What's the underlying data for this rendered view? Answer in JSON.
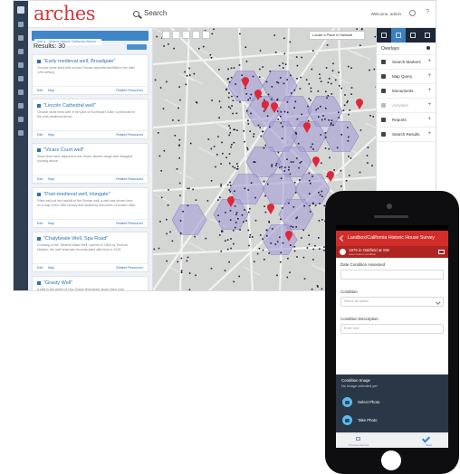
{
  "app": {
    "logo": "arches",
    "search_label": "Search",
    "welcome": "Welcome, admin",
    "help_glyph": "?"
  },
  "results": {
    "filter_tag": "Add a... Search Historic California Historic...",
    "count_label": "Results: 30",
    "items": [
      {
        "title": "\"Early medieval well, Broadgate\"",
        "desc": "Circular stone lined well cut into Roman deposits identified in the later 12th century.",
        "link1": "Edit",
        "link2": "Map",
        "related": "Related Resources"
      },
      {
        "title": "\"Lincoln Cathedral well\"",
        "desc": "Circular stone lined well in the yard of Exchequer Gate, constructed in the post-medieval period.",
        "link1": "Edit",
        "link2": "Map",
        "related": "Related Resources"
      },
      {
        "title": "\"Vicars Court well\"",
        "desc": "Stone lined well, adjacent to the Vicars' kitchen range with drawgear housing above.",
        "link1": "Edit",
        "link2": "Map",
        "related": "Related Resources"
      },
      {
        "title": "\"Post-medieval well, Hungate\"",
        "desc": "Filled well cut into backfill of the Roman wall; a well was shown here on a map of the 18th century and sealed by structures of modern date.",
        "link1": "Edit",
        "link2": "Map",
        "related": "Related Resources"
      },
      {
        "title": "\"Chalybeate Well, Spa Road\"",
        "desc": "Covering of the \"Mineral Water Well\" opened in 1834 by Thomas Haddon, the well head was reconstructed with brick in 1919.",
        "link1": "Edit",
        "link2": "Map",
        "related": "Related Resources"
      },
      {
        "title": "\"Grasty Well\"",
        "desc": "A well in the centre of Hoy Grasty Hmpstead, stone lined, now covered.",
        "link1": "Edit",
        "link2": "Map",
        "related": "Related Resources"
      }
    ]
  },
  "map": {
    "layer_select": "Locate a Place in Hallstatt",
    "hex_fill": "#a49dd8",
    "marker_color": "#e0263a",
    "point_color": "#2a1a3e"
  },
  "overlays": {
    "title": "Overlays",
    "items": [
      {
        "label": "Search Markers",
        "icon": "marker-icon",
        "dim": false
      },
      {
        "label": "Map Query",
        "icon": "query-icon",
        "dim": false
      },
      {
        "label": "Monuments",
        "icon": "monument-icon",
        "dim": false
      },
      {
        "label": "Activities",
        "icon": "activity-icon",
        "dim": true
      },
      {
        "label": "Reports",
        "icon": "report-icon",
        "dim": false
      },
      {
        "label": "Search Results",
        "icon": "search-results-icon",
        "dim": false
      }
    ]
  },
  "mobile": {
    "header_title": "Landbox/California Historic House Survey",
    "sub_title": "1976 in Oakfield at SW",
    "sub_caption": "Lorem ipsum condition",
    "fields": [
      {
        "label": "Date Condition Assessed",
        "placeholder": ""
      },
      {
        "label": "Condition",
        "placeholder": "Select an option"
      },
      {
        "label": "Condition Description",
        "placeholder": "Enter text"
      }
    ],
    "image_title": "Condition Image",
    "image_sub": "No image selected yet",
    "actions": [
      "Select Photo",
      "Take Photo"
    ],
    "nav_left": "Previous Record",
    "nav_right": "Save"
  },
  "colors": {
    "brand_red": "#d32d29",
    "link_blue": "#2c72b5",
    "rail_dark": "#2f3f52"
  }
}
